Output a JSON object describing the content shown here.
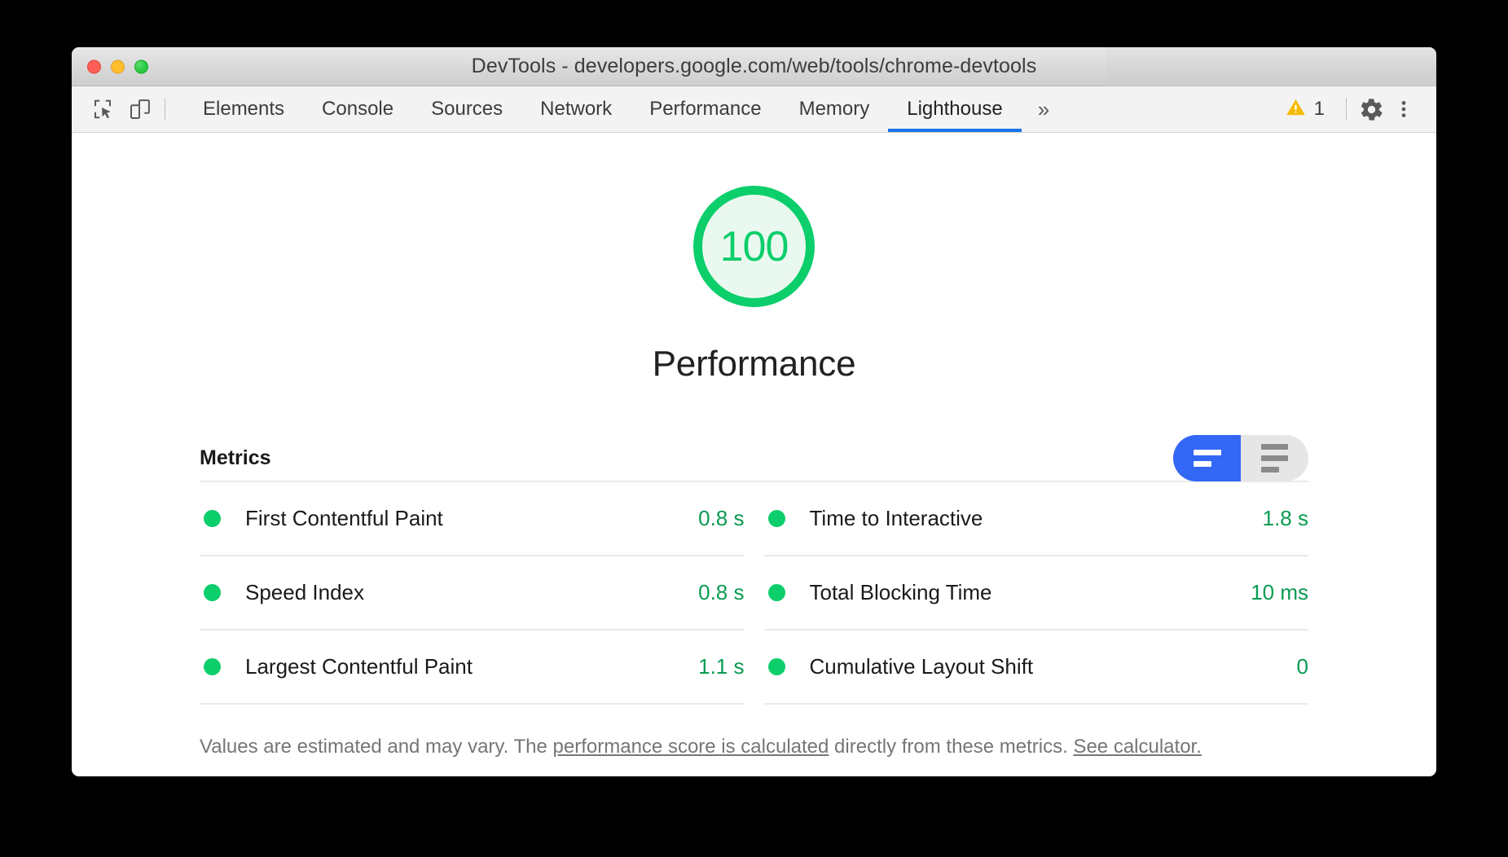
{
  "window": {
    "title": "DevTools - developers.google.com/web/tools/chrome-devtools",
    "traffic_lights": [
      "close",
      "minimize",
      "maximize"
    ]
  },
  "toolbar": {
    "left_icons": [
      {
        "name": "inspect-element-icon",
        "label": "Inspect element"
      },
      {
        "name": "device-toolbar-icon",
        "label": "Toggle device toolbar"
      }
    ],
    "tabs": [
      {
        "label": "Elements",
        "active": false
      },
      {
        "label": "Console",
        "active": false
      },
      {
        "label": "Sources",
        "active": false
      },
      {
        "label": "Network",
        "active": false
      },
      {
        "label": "Performance",
        "active": false
      },
      {
        "label": "Memory",
        "active": false
      },
      {
        "label": "Lighthouse",
        "active": true
      }
    ],
    "more_tabs_label": "»",
    "warning_count": "1",
    "settings_label": "Settings",
    "menu_label": "Customize and control DevTools",
    "active_tab_underline_color": "#1a73e8",
    "warning_color": "#f5bb00"
  },
  "report": {
    "gauge": {
      "score": "100",
      "category": "Performance",
      "score_color": "#0cce6b",
      "fill_color": "#eaf9f0",
      "percent": 100
    },
    "metrics_header": {
      "title": "Metrics",
      "toggle": {
        "active_color": "#3367f6",
        "inactive_color": "#e6e6e6",
        "options": [
          {
            "name": "timeline-view",
            "selected": true
          },
          {
            "name": "list-view",
            "selected": false
          }
        ]
      }
    },
    "metrics": [
      {
        "name": "First Contentful Paint",
        "value": "0.8 s",
        "status": "pass",
        "status_color": "#0cce6b"
      },
      {
        "name": "Time to Interactive",
        "value": "1.8 s",
        "status": "pass",
        "status_color": "#0cce6b"
      },
      {
        "name": "Speed Index",
        "value": "0.8 s",
        "status": "pass",
        "status_color": "#0cce6b"
      },
      {
        "name": "Total Blocking Time",
        "value": "10 ms",
        "status": "pass",
        "status_color": "#0cce6b"
      },
      {
        "name": "Largest Contentful Paint",
        "value": "1.1 s",
        "status": "pass",
        "status_color": "#0cce6b"
      },
      {
        "name": "Cumulative Layout Shift",
        "value": "0",
        "status": "pass",
        "status_color": "#0cce6b"
      }
    ],
    "disclaimer": {
      "part1": "Values are estimated and may vary. The ",
      "link1": "performance score is calculated",
      "part2": " directly from these metrics. ",
      "link2": "See calculator."
    }
  }
}
